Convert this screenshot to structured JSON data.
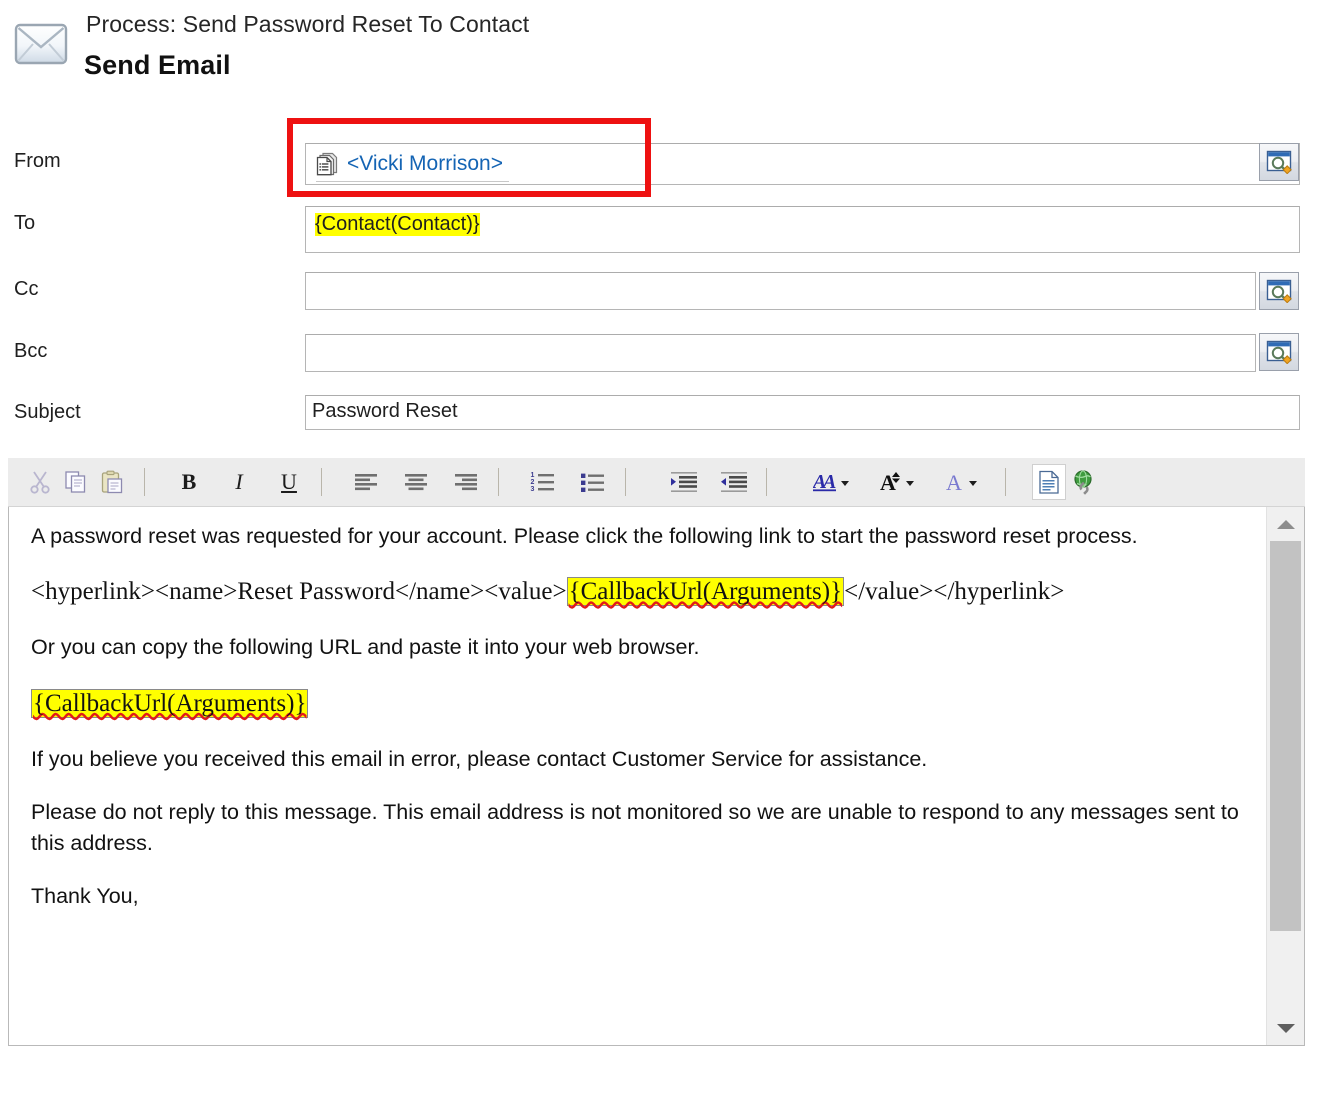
{
  "header": {
    "subtitle": "Process: Send Password Reset To Contact",
    "title": "Send Email",
    "icon": "envelope-icon"
  },
  "form": {
    "from": {
      "label": "From",
      "value": "<Vicki Morrison>",
      "value_color": "#1464b4",
      "record_icon": "record-stack-icon",
      "lookup_icon": "lookup-search-icon",
      "highlight_rect_color": "#ee1111"
    },
    "to": {
      "label": "To",
      "value": "{Contact(Contact)}",
      "highlight_color": "#ffff00",
      "placeholder": ""
    },
    "cc": {
      "label": "Cc",
      "value": "",
      "placeholder": "",
      "lookup_icon": "lookup-search-icon"
    },
    "bcc": {
      "label": "Bcc",
      "value": "",
      "placeholder": "",
      "lookup_icon": "lookup-search-icon"
    },
    "subject": {
      "label": "Subject",
      "value": "Password Reset",
      "placeholder": ""
    }
  },
  "toolbar": {
    "buttons": [
      {
        "name": "cut-icon",
        "label": "Cut"
      },
      {
        "name": "copy-icon",
        "label": "Copy"
      },
      {
        "name": "paste-icon",
        "label": "Paste"
      },
      {
        "name": "bold-icon",
        "label": "B"
      },
      {
        "name": "italic-icon",
        "label": "I"
      },
      {
        "name": "underline-icon",
        "label": "U"
      },
      {
        "name": "align-left-icon",
        "label": "Align Left"
      },
      {
        "name": "align-center-icon",
        "label": "Align Center"
      },
      {
        "name": "align-right-icon",
        "label": "Align Right"
      },
      {
        "name": "numbered-list-icon",
        "label": "Numbered List"
      },
      {
        "name": "bulleted-list-icon",
        "label": "Bulleted List"
      },
      {
        "name": "increase-indent-icon",
        "label": "Increase Indent"
      },
      {
        "name": "decrease-indent-icon",
        "label": "Decrease Indent"
      },
      {
        "name": "font-name-icon",
        "label": "Font"
      },
      {
        "name": "font-size-icon",
        "label": "Font Size"
      },
      {
        "name": "font-color-icon",
        "label": "Font Color"
      },
      {
        "name": "source-view-icon",
        "label": "Source"
      },
      {
        "name": "insert-hyperlink-icon",
        "label": "Insert Hyperlink"
      }
    ]
  },
  "body": {
    "p1": "A password reset was requested for your account. Please click the following link to start the password reset process.",
    "p2_pre": "<hyperlink><name>Reset Password</name><value>",
    "p2_token": "{CallbackUrl(Arguments)}",
    "p2_post": "</value></hyperlink>",
    "p3": "Or you can copy the following URL and paste it into your web browser.",
    "p4_token": "{CallbackUrl(Arguments)}",
    "p5": "If you believe you received this email in error, please contact Customer Service for assistance.",
    "p6": "Please do not reply to this message. This email address is not monitored so we are unable to respond to any messages sent to this address.",
    "p7": "Thank You,",
    "token_highlight_color": "#ffff00",
    "misspelling_underline_color": "#e01b1b"
  },
  "scrollbar": {
    "up_arrow": "scroll-up-icon",
    "down_arrow": "scroll-down-icon"
  }
}
